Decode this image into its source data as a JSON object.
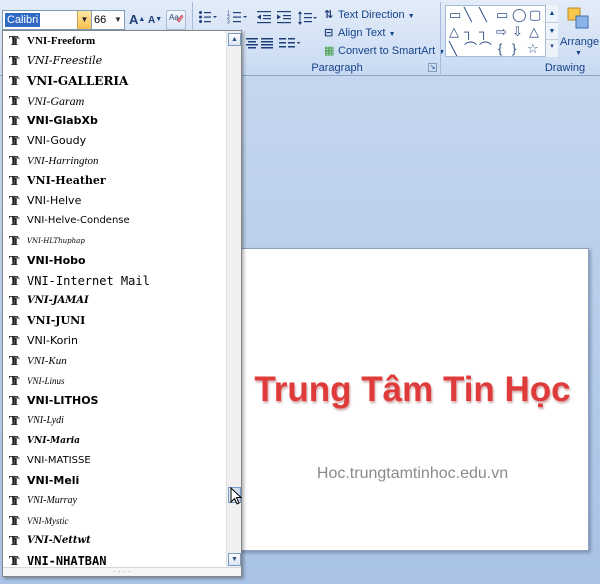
{
  "ribbon": {
    "font_name": "Calibri",
    "font_size": "66",
    "grow_font": "A",
    "shrink_font": "A",
    "text_direction": "Text Direction",
    "align_text": "Align Text",
    "convert_smartart": "Convert to SmartArt",
    "paragraph_label": "Paragraph",
    "drawing_label": "Drawing",
    "arrange_label": "Arrange"
  },
  "font_list": [
    {
      "name": "VNI-Freeform",
      "family": "\"Liberation Serif\", serif",
      "size": 11,
      "weight": "bold",
      "style": "normal"
    },
    {
      "name": "VNI-Freestile",
      "family": "\"DejaVu Serif\", serif",
      "size": 11,
      "weight": "normal",
      "style": "italic"
    },
    {
      "name": "VNI-GALLERIA",
      "family": "\"DejaVu Serif\", serif",
      "size": 12,
      "weight": "bold",
      "style": "normal"
    },
    {
      "name": "VNI-Garam",
      "family": "\"Liberation Serif\", serif",
      "size": 12,
      "weight": "normal",
      "style": "italic"
    },
    {
      "name": "VNI-GlabXb",
      "family": "\"DejaVu Sans\", sans-serif",
      "size": 11,
      "weight": "bold",
      "style": "normal"
    },
    {
      "name": "VNI-Goudy",
      "family": "\"DejaVu Sans\", sans-serif",
      "size": 11,
      "weight": "normal",
      "style": "normal"
    },
    {
      "name": "VNI-Harrington",
      "family": "\"Liberation Serif\", serif",
      "size": 11,
      "weight": "normal",
      "style": "italic"
    },
    {
      "name": "VNI-Heather",
      "family": "\"DejaVu Serif\", serif",
      "size": 11,
      "weight": "bold",
      "style": "normal"
    },
    {
      "name": "VNI-Helve",
      "family": "\"DejaVu Sans\", sans-serif",
      "size": 11,
      "weight": "normal",
      "style": "normal"
    },
    {
      "name": "VNI-Helve-Condense",
      "family": "\"DejaVu Sans\", sans-serif",
      "size": 10,
      "weight": "normal",
      "style": "normal"
    },
    {
      "name": "VNI-HLThuphap",
      "family": "\"DejaVu Serif\", serif",
      "size": 7,
      "weight": "normal",
      "style": "italic"
    },
    {
      "name": "VNI-Hobo",
      "family": "\"DejaVu Sans\", sans-serif",
      "size": 11,
      "weight": "bold",
      "style": "normal"
    },
    {
      "name": "VNI-Internet Mail",
      "family": "\"DejaVu Sans Mono\", monospace",
      "size": 12,
      "weight": "normal",
      "style": "normal"
    },
    {
      "name": "VNI-JAMAI",
      "family": "\"DejaVu Serif\", serif",
      "size": 10,
      "weight": "bold",
      "style": "italic"
    },
    {
      "name": "VNI-JUNI",
      "family": "\"DejaVu Serif\", serif",
      "size": 11,
      "weight": "bold",
      "style": "normal"
    },
    {
      "name": "VNI-Korin",
      "family": "\"DejaVu Sans\", sans-serif",
      "size": 11,
      "weight": "normal",
      "style": "normal"
    },
    {
      "name": "VNI-Kun",
      "family": "\"Liberation Serif\", serif",
      "size": 11,
      "weight": "normal",
      "style": "italic"
    },
    {
      "name": "VNI-Linus",
      "family": "\"Liberation Serif\", serif",
      "size": 9,
      "weight": "normal",
      "style": "italic"
    },
    {
      "name": "VNI-LITHOS",
      "family": "\"DejaVu Sans\", sans-serif",
      "size": 11,
      "weight": "bold",
      "style": "normal"
    },
    {
      "name": "VNI-Lydi",
      "family": "\"Liberation Serif\", serif",
      "size": 10,
      "weight": "normal",
      "style": "italic"
    },
    {
      "name": "VNI-Maria",
      "family": "\"DejaVu Serif\", serif",
      "size": 9,
      "weight": "bold",
      "style": "italic"
    },
    {
      "name": "VNI-MATISSE",
      "family": "\"DejaVu Sans\", sans-serif",
      "size": 10,
      "weight": "normal",
      "style": "normal"
    },
    {
      "name": "VNI-Meli",
      "family": "\"DejaVu Sans\", sans-serif",
      "size": 11,
      "weight": "bold",
      "style": "normal"
    },
    {
      "name": "VNI-Murray",
      "family": "\"Liberation Serif\", serif",
      "size": 10,
      "weight": "normal",
      "style": "italic"
    },
    {
      "name": "VNI-Mystic",
      "family": "\"Liberation Serif\", serif",
      "size": 9,
      "weight": "normal",
      "style": "italic"
    },
    {
      "name": "VNI-Nettwt",
      "family": "\"DejaVu Serif\", serif",
      "size": 10,
      "weight": "bold",
      "style": "italic"
    },
    {
      "name": "VNI-NHATBAN",
      "family": "\"DejaVu Sans Mono\", monospace",
      "size": 12,
      "weight": "bold",
      "style": "normal"
    }
  ],
  "slide": {
    "title": "Trung Tâm Tin Học",
    "subtitle": "Hoc.trungtamtinhoc.edu.vn"
  },
  "colors": {
    "title_red": "#e03b3b",
    "subtitle_gray": "#8a8a8a",
    "ribbon_text": "#15428b",
    "selection_blue": "#316ac5"
  }
}
